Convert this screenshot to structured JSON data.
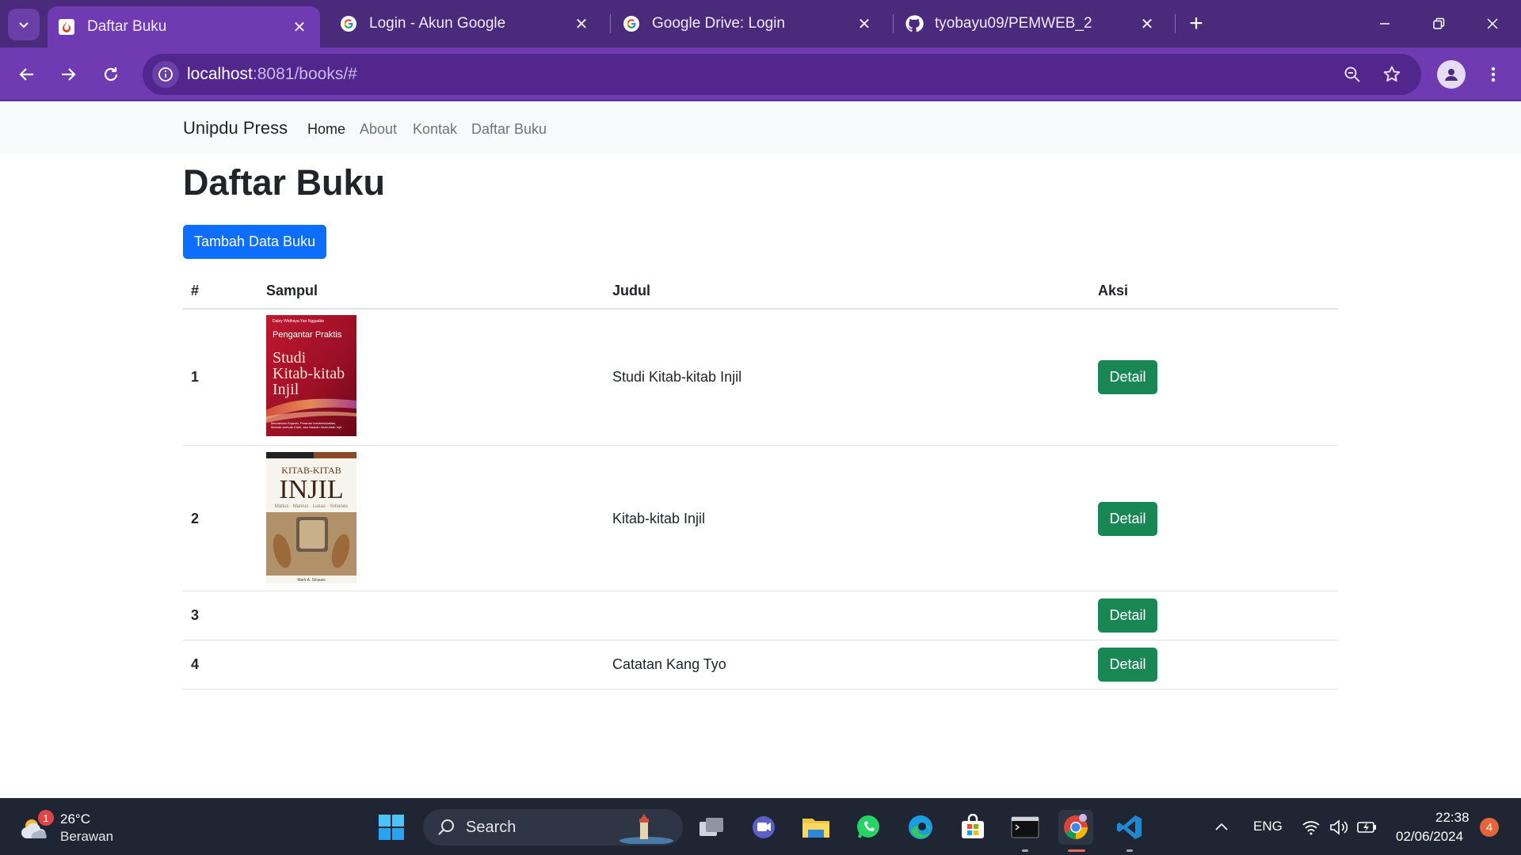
{
  "browser": {
    "tabs": [
      {
        "title": "Daftar Buku",
        "icon": "codeigniter-flame-icon",
        "active": true
      },
      {
        "title": "Login - Akun Google",
        "icon": "google-g-icon",
        "active": false
      },
      {
        "title": "Google Drive: Login",
        "icon": "google-g-icon",
        "active": false
      },
      {
        "title": "tyobayu09/PEMWEB_2",
        "icon": "github-icon",
        "active": false
      }
    ],
    "url_host": "localhost",
    "url_rest": ":8081/books/#",
    "accent": "#6f3ab2"
  },
  "navbar": {
    "brand": "Unipdu Press",
    "links": [
      {
        "label": "Home",
        "active": true
      },
      {
        "label": "About",
        "active": false
      },
      {
        "label": "Kontak",
        "active": false
      },
      {
        "label": "Daftar Buku",
        "active": false
      }
    ]
  },
  "main": {
    "title": "Daftar Buku",
    "add_button": "Tambah Data Buku",
    "table": {
      "headers": [
        "#",
        "Sampul",
        "Judul",
        "Aksi"
      ],
      "rows": [
        {
          "num": "1",
          "judul": "Studi Kitab-kitab Injil",
          "action": "Detail",
          "cover": {
            "author": "Daley Widhaya Yan Nggadde",
            "title_small": "Pengantar Praktis",
            "title_big1": "Studi",
            "title_big2": "Kitab-kitab",
            "title_big3": "Injil",
            "subtitle": "Memahami Sejarah, Peranan Intertekstualitas, Metode-metode Kritik, dan Naskah Kitab-kitab Injil"
          }
        },
        {
          "num": "2",
          "judul": "Kitab-kitab Injil",
          "action": "Detail",
          "cover": {
            "title_small": "KITAB-KITAB",
            "title_big": "INJIL",
            "subtitle": "Matius · Markus · Lukas · Yohanes",
            "author": "Mark A. Strauss"
          }
        },
        {
          "num": "3",
          "judul": "",
          "action": "Detail"
        },
        {
          "num": "4",
          "judul": "Catatan Kang Tyo",
          "action": "Detail"
        }
      ]
    },
    "primary_color": "#0d6efd",
    "success_color": "#198754"
  },
  "taskbar": {
    "weather_temp": "26°C",
    "weather_cond": "Berawan",
    "weather_badge": "1",
    "search_label": "Search",
    "lang": "ENG",
    "time": "22:38",
    "date": "02/06/2024",
    "notif_count": "4"
  }
}
